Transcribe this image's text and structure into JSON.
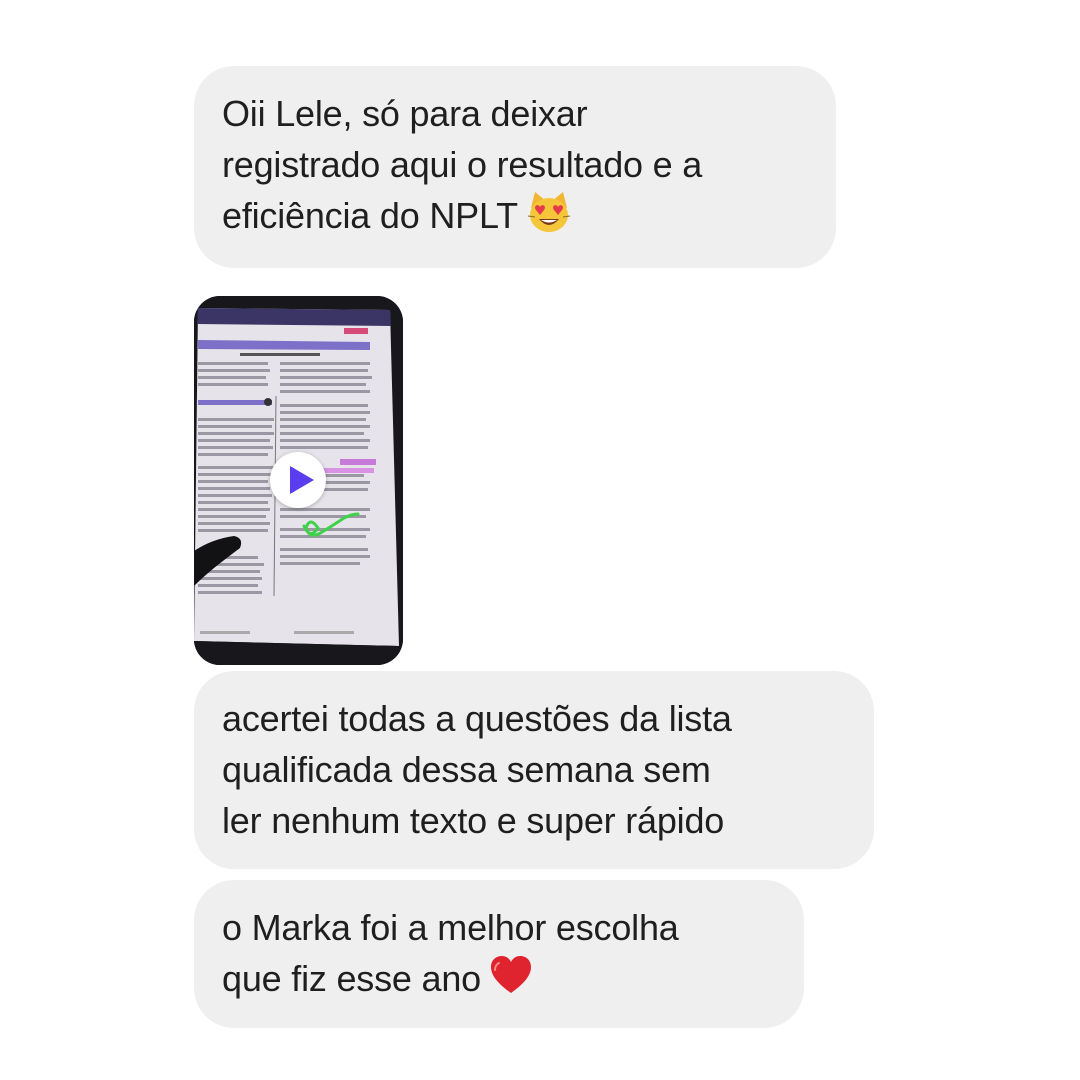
{
  "messages": [
    {
      "lines": [
        "Oii Lele, só para deixar",
        "registrado aqui o resultado e a",
        "eficiência do NPLT"
      ],
      "emoji": "smiling-cat-heart-eyes-icon"
    },
    {
      "type": "video",
      "thumbnail": "tablet-document-highlighted-thumbnail",
      "control": "play-icon"
    },
    {
      "lines": [
        "acertei todas a questões da lista",
        "qualificada dessa semana sem",
        "ler nenhum texto e super rápido"
      ]
    },
    {
      "lines": [
        "o Marka foi a melhor escolha",
        "que fiz esse ano"
      ],
      "emoji": "red-heart-icon"
    }
  ],
  "colors": {
    "bubble": "#efefef",
    "text": "#1f1f1f",
    "play_icon": "#5b3df0",
    "heart": "#e0242f"
  }
}
